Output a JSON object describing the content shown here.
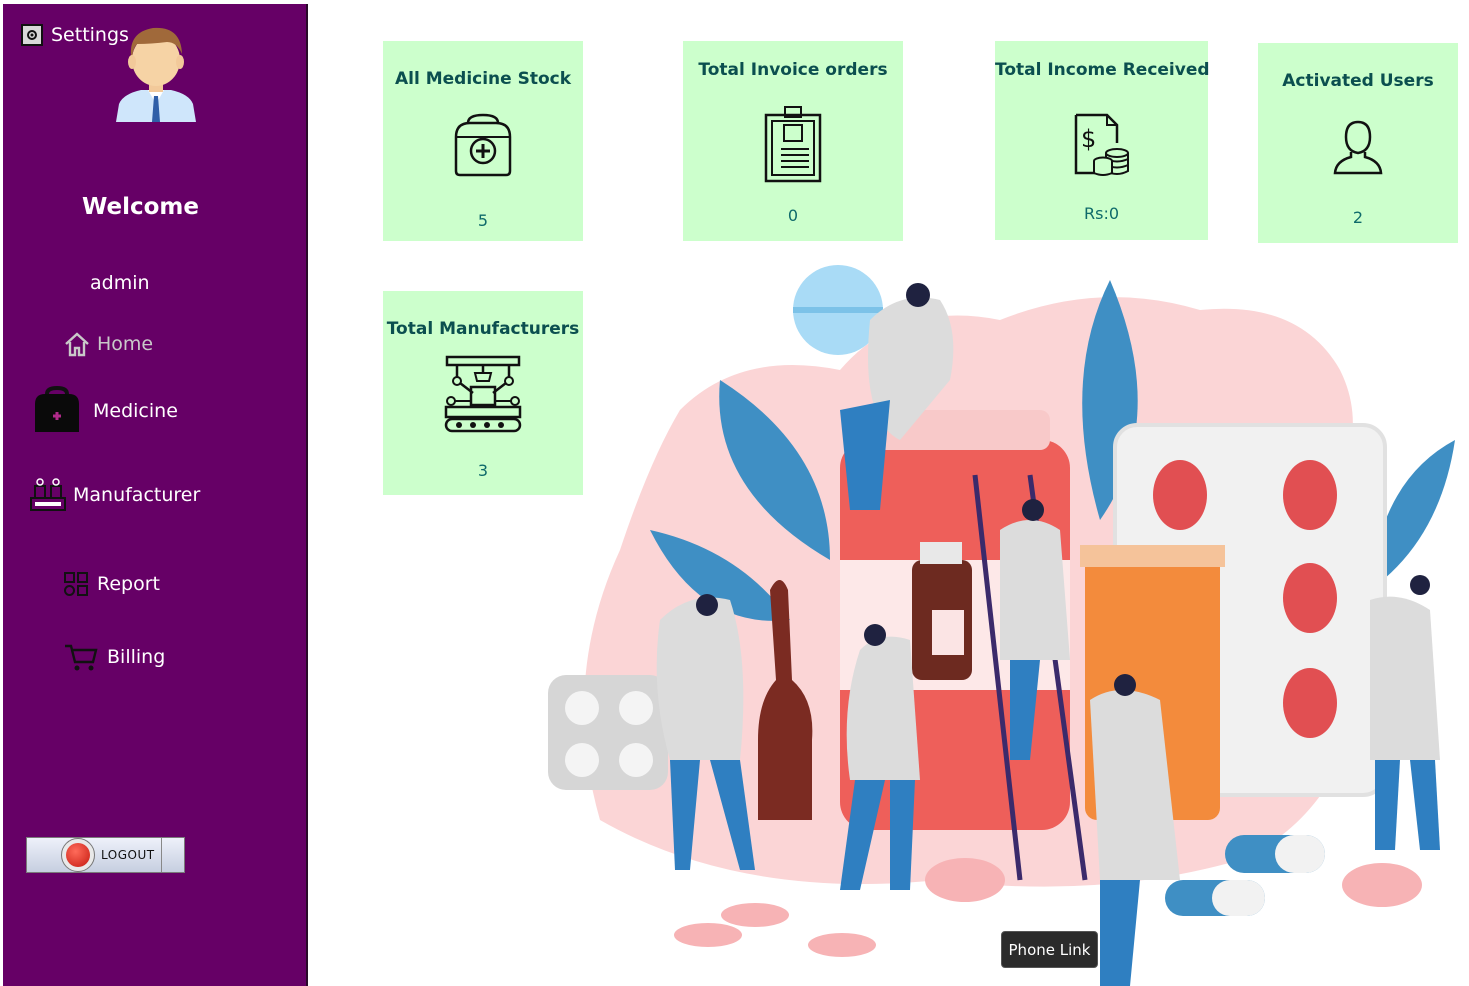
{
  "sidebar": {
    "settings_label": "Settings",
    "welcome": "Welcome",
    "username": "admin",
    "nav": {
      "home": "Home",
      "medicine": "Medicine",
      "manufacturer": "Manufacturer",
      "report": "Report",
      "billing": "Billing"
    },
    "logout_label": "LOGOUT"
  },
  "cards": {
    "medicine_stock": {
      "title": "All Medicine Stock",
      "value": "5"
    },
    "invoice_orders": {
      "title": "Total Invoice orders",
      "value": "0"
    },
    "income_received": {
      "title": "Total Income Received",
      "value": "Rs:0"
    },
    "activated_users": {
      "title": "Activated Users",
      "value": "2"
    },
    "manufacturers": {
      "title": "Total Manufacturers",
      "value": "3"
    }
  },
  "tooltip": "Phone Link",
  "colors": {
    "sidebar": "#660066",
    "card": "#ccffcc",
    "card_text": "#0b4f4f"
  }
}
